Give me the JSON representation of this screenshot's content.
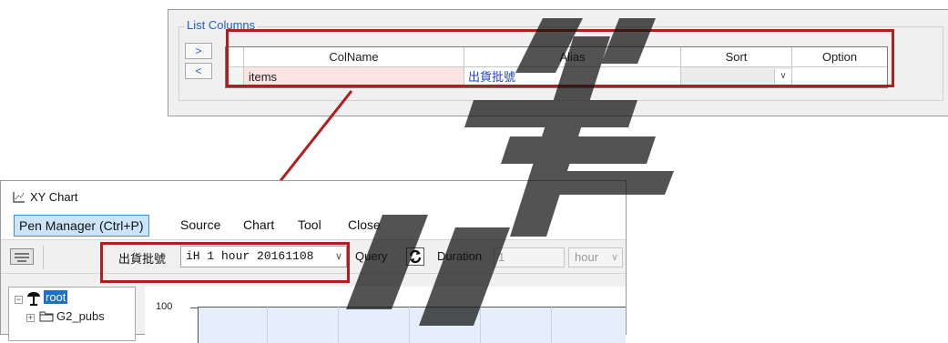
{
  "list_columns": {
    "title": "List Columns",
    "btn_right": ">",
    "btn_left": "<",
    "headers": [
      "ColName",
      "Alias",
      "Sort",
      "Option"
    ],
    "row": {
      "colname": "items",
      "alias": "出貨批號",
      "sort": "",
      "option": ""
    }
  },
  "xy_chart": {
    "window_title": "XY Chart",
    "menu": {
      "pen_manager": "Pen Manager (Ctrl+P)",
      "source": "Source",
      "chart": "Chart",
      "tool": "Tool",
      "close": "Close"
    },
    "toolbar": {
      "field_label": "出貨批號",
      "combo_value": "iH 1 hour 20161108",
      "query_label": "Query",
      "duration_label": "Duration",
      "duration_value": "1",
      "unit_value": "hour"
    },
    "tree": {
      "root_label": "root",
      "child_label": "G2_pubs"
    },
    "chart": {
      "y_top_tick": "100"
    }
  },
  "colors": {
    "highlight_red": "#b11e1e",
    "link_blue": "#1f5fbf",
    "selected_pink": "#fde3e3",
    "menu_active": "#cce4f7"
  }
}
